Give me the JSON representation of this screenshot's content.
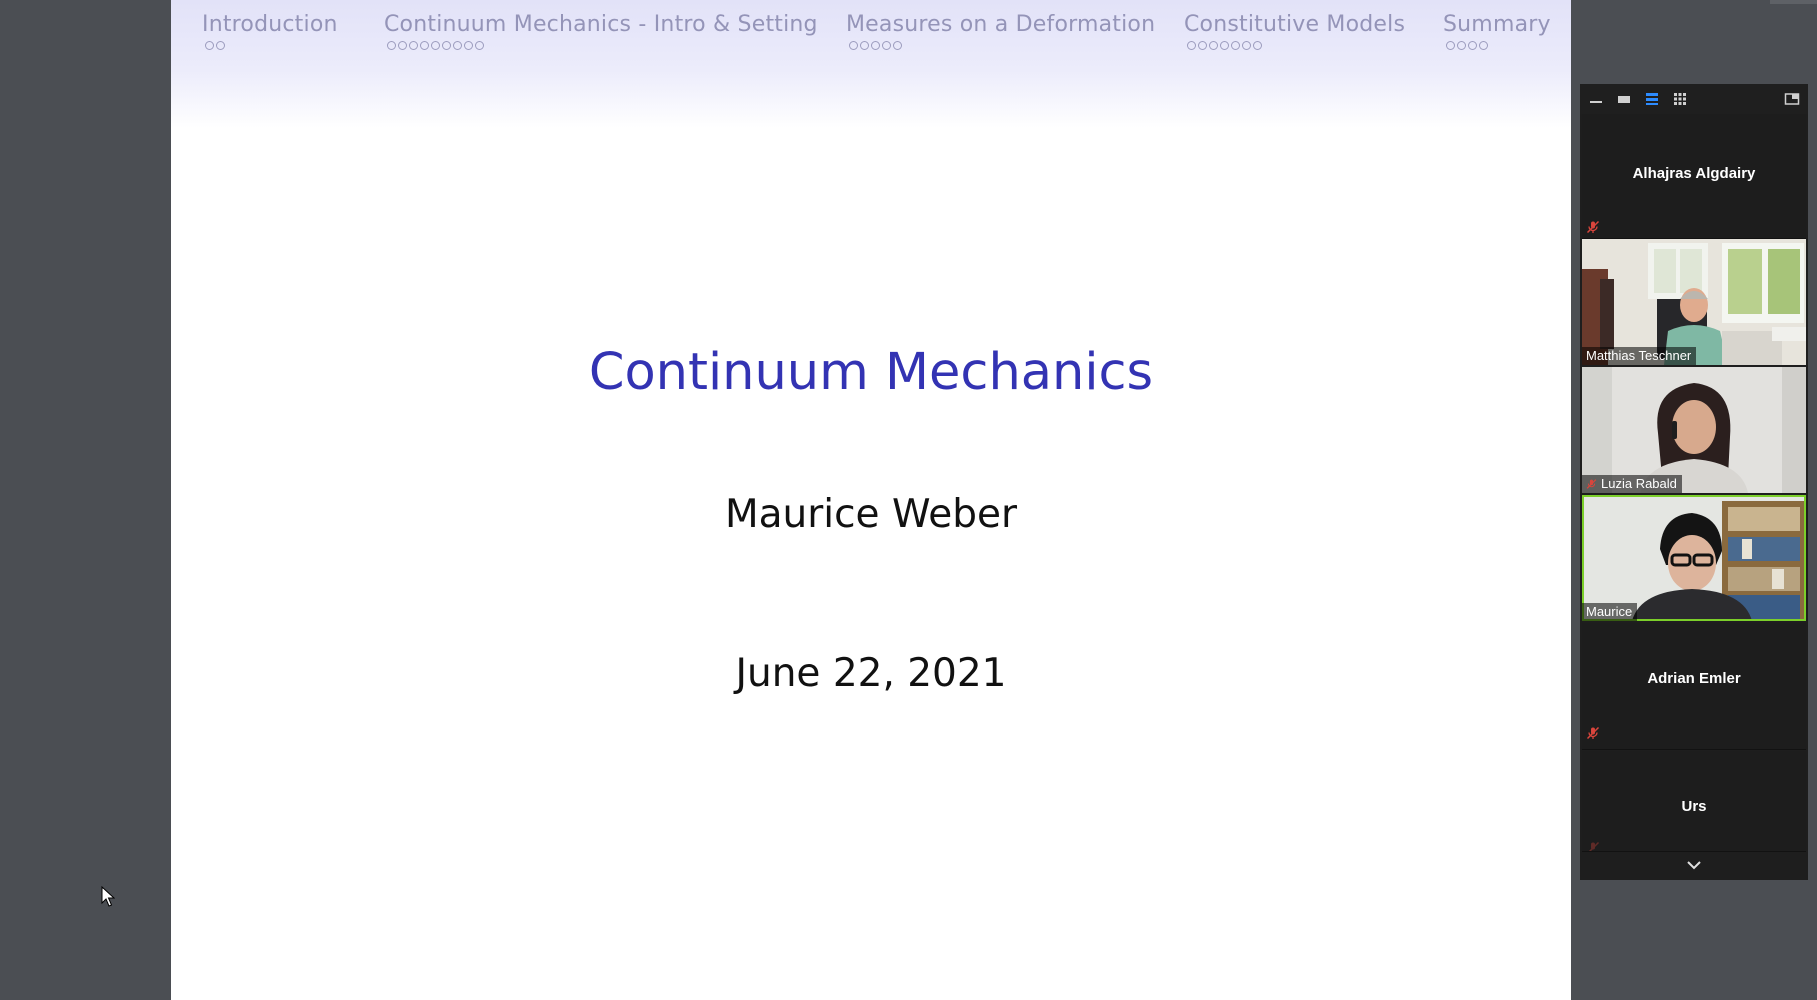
{
  "slide": {
    "nav": [
      {
        "label": "Introduction",
        "dots": 2
      },
      {
        "label": "Continuum Mechanics - Intro & Setting",
        "dots": 9
      },
      {
        "label": "Measures on a Deformation",
        "dots": 5
      },
      {
        "label": "Constitutive Models",
        "dots": 7
      },
      {
        "label": "Summary",
        "dots": 4
      }
    ],
    "title": "Continuum Mechanics",
    "author": "Maurice Weber",
    "date": "June 22, 2021"
  },
  "participants": [
    {
      "name": "Alhajras Algdairy",
      "video": false,
      "muted": true
    },
    {
      "name": "Matthias Teschner",
      "video": true,
      "muted": false
    },
    {
      "name": "Luzia Rabald",
      "video": true,
      "muted": true
    },
    {
      "name": "Maurice",
      "video": true,
      "muted": false,
      "active_speaker": true
    },
    {
      "name": "Adrian Emler",
      "video": false,
      "muted": true
    },
    {
      "name": "Urs",
      "video": false,
      "muted": true
    }
  ],
  "toolbar_icons": [
    "minimize-icon",
    "thumbnail-view-icon",
    "speaker-view-icon",
    "gallery-view-icon",
    "exit-pip-icon"
  ],
  "colors": {
    "slide_title": "#3333b3",
    "nav_text": "#9494b8",
    "active_speaker_border": "#7ccf2a",
    "mute_icon": "#d9453c",
    "panel_bg": "#1e1e1e",
    "desktop_bg": "#4b4e53"
  }
}
